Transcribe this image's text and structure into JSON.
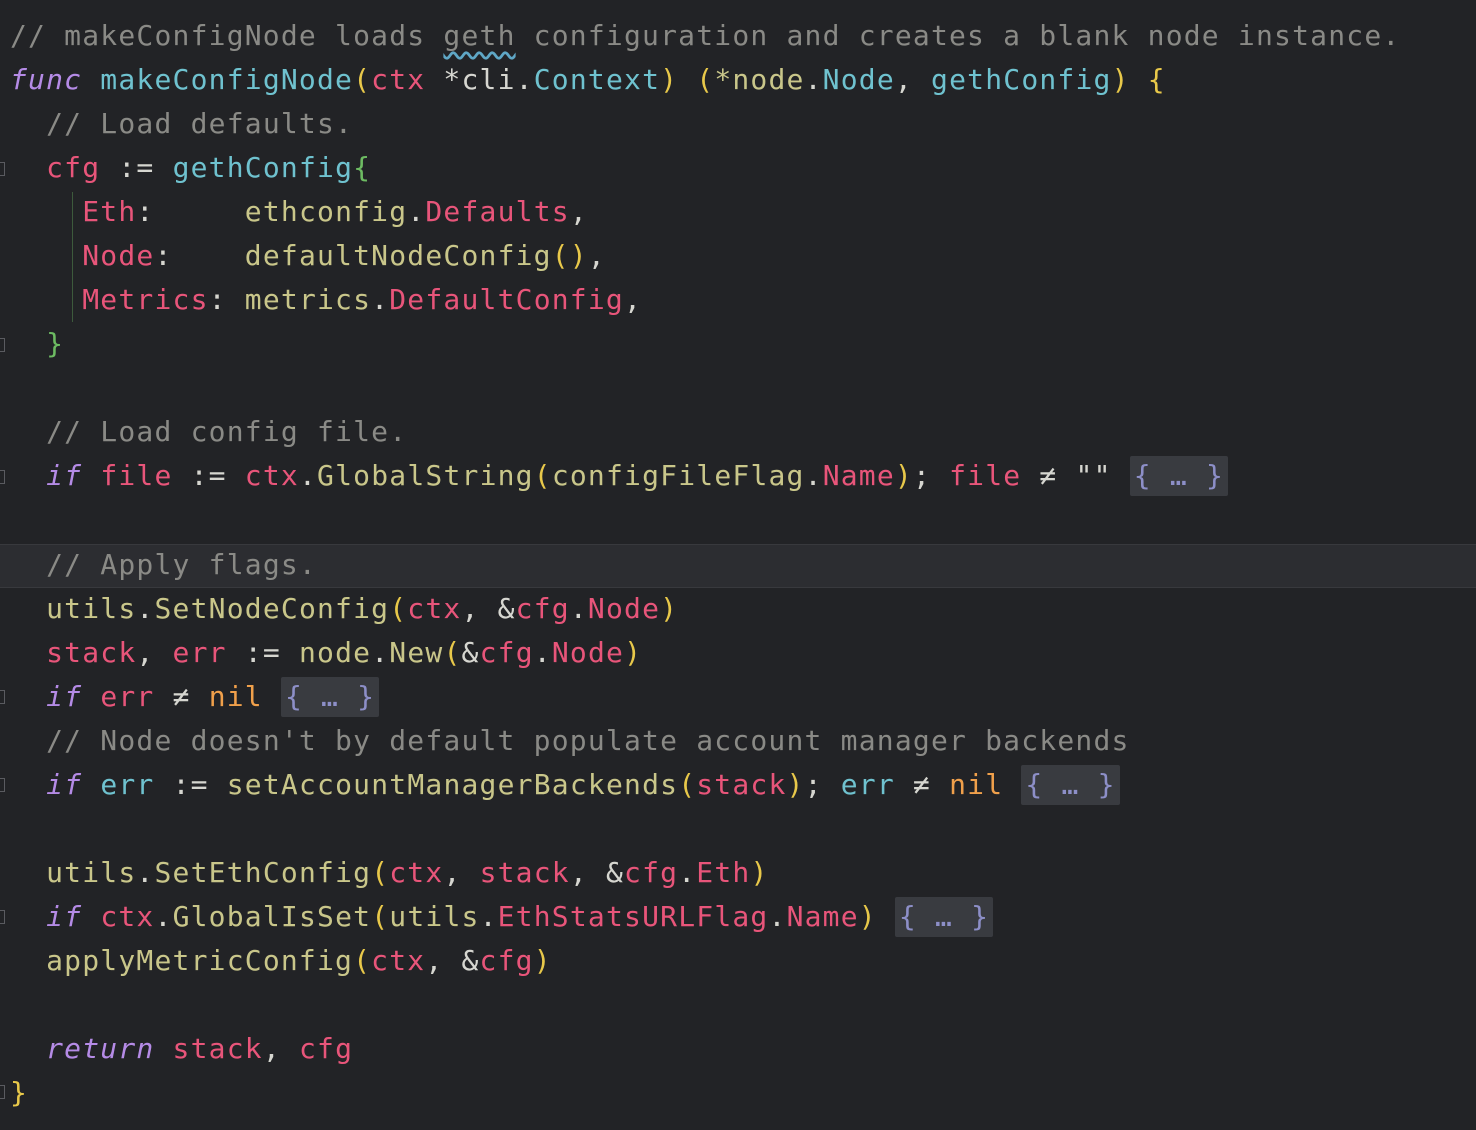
{
  "editor": {
    "comment_top_1": "// makeConfigNode loads ",
    "comment_top_geth": "geth",
    "comment_top_2": " configuration and creates a blank node instance.",
    "fn_keyword": "func",
    "fn_name": "makeConfigNode",
    "param_ctx": "ctx",
    "param_type_pkg": "*cli",
    "param_type": "Context",
    "ret_node_pkg": "*node",
    "ret_node_type": "Node",
    "ret_cfg_type": "gethConfig",
    "comment_load_defaults": "// Load defaults.",
    "cfg_var": "cfg",
    "assign_op": ":=",
    "cfg_type": "gethConfig",
    "field_eth": "Eth",
    "val_ethconfig": "ethconfig",
    "val_defaults": "Defaults",
    "field_node": "Node",
    "val_default_node_config": "defaultNodeConfig",
    "field_metrics": "Metrics",
    "val_metrics": "metrics",
    "val_default_config": "DefaultConfig",
    "comment_load_config": "// Load config file.",
    "kw_if": "if",
    "var_file": "file",
    "call_global_string": "GlobalString",
    "config_file_flag": "configFileFlag",
    "field_name": "Name",
    "neq": "≠",
    "empty_string": "\"\"",
    "fold_placeholder": "{ … }",
    "comment_apply_flags": "// Apply flags.",
    "pkg_utils": "utils",
    "call_set_node_config": "SetNodeConfig",
    "var_stack": "stack",
    "var_err": "err",
    "pkg_node": "node",
    "call_new": "New",
    "lit_nil": "nil",
    "comment_node_backends": "// Node doesn't by default populate account manager backends",
    "call_set_account_manager_backends": "setAccountManagerBackends",
    "call_set_eth_config": "SetEthConfig",
    "call_global_is_set": "GlobalIsSet",
    "eth_stats_url_flag": "EthStatsURLFlag",
    "call_apply_metric_config": "applyMetricConfig",
    "kw_return": "return"
  }
}
